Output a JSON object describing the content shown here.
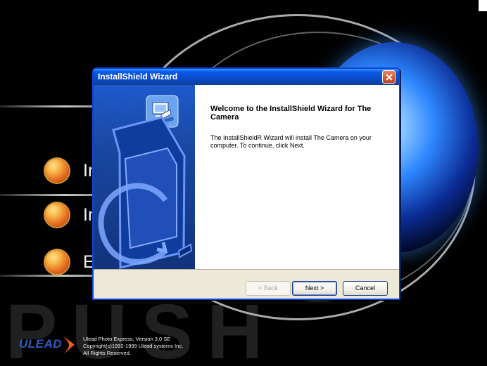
{
  "background": {
    "top_caption": "",
    "menu_items": [
      {
        "label": "In"
      },
      {
        "label": "In"
      },
      {
        "label": "E"
      }
    ],
    "wordmark": "PUSH",
    "logo": "ULEAD",
    "copyright_lines": [
      "Ulead Photo Express, Version 3.0 SE",
      "Copyright(c)1992-1999 Ulead systems Inc.",
      "All Rights Reserved."
    ]
  },
  "dialog": {
    "title": "InstallShield Wizard",
    "heading": "Welcome to the InstallShield Wizard for The Camera",
    "body": "The InstallShieldR Wizard will install The Camera on your computer.  To continue, click Next.",
    "buttons": {
      "back": "< Back",
      "next": "Next >",
      "cancel": "Cancel"
    }
  },
  "icons": {
    "title_close": "close-icon",
    "wizard_illustration": "computer-setup-icon",
    "logo_swoosh": "swoosh-icon"
  }
}
